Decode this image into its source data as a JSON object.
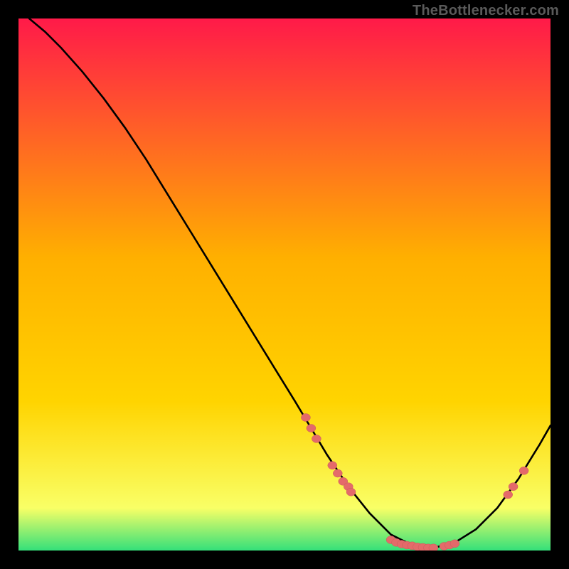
{
  "watermark": "TheBottlenecker.com",
  "colors": {
    "gradient_top": "#ff1a49",
    "gradient_mid": "#ffd400",
    "gradient_low": "#f9ff66",
    "gradient_bottom": "#34e07a",
    "curve": "#000000",
    "marker": "#e46a6a",
    "marker_stroke": "#c95a5a",
    "frame": "#000000"
  },
  "chart_data": {
    "type": "line",
    "title": "",
    "xlabel": "",
    "ylabel": "",
    "xlim": [
      0,
      100
    ],
    "ylim": [
      0,
      100
    ],
    "grid": false,
    "series": [
      {
        "name": "bottleneck-curve",
        "x": [
          2,
          5,
          8,
          12,
          16,
          20,
          24,
          28,
          32,
          36,
          40,
          44,
          48,
          52,
          55,
          58,
          62,
          66,
          70,
          74,
          78,
          82,
          86,
          90,
          94,
          98,
          100
        ],
        "y": [
          100,
          97.5,
          94.5,
          90,
          85,
          79.5,
          73.5,
          67,
          60.5,
          54,
          47.5,
          41,
          34.5,
          28,
          23,
          18,
          12,
          7,
          3,
          1,
          0.5,
          1.5,
          4,
          8,
          13.5,
          20,
          23.5
        ]
      }
    ],
    "markers": [
      {
        "x": 54,
        "y": 25
      },
      {
        "x": 55,
        "y": 23
      },
      {
        "x": 56,
        "y": 21
      },
      {
        "x": 59,
        "y": 16
      },
      {
        "x": 60,
        "y": 14.5
      },
      {
        "x": 61,
        "y": 13
      },
      {
        "x": 62,
        "y": 12
      },
      {
        "x": 62.5,
        "y": 11
      },
      {
        "x": 70,
        "y": 2
      },
      {
        "x": 71,
        "y": 1.5
      },
      {
        "x": 72,
        "y": 1.2
      },
      {
        "x": 73,
        "y": 1
      },
      {
        "x": 74,
        "y": 0.9
      },
      {
        "x": 75,
        "y": 0.7
      },
      {
        "x": 76,
        "y": 0.6
      },
      {
        "x": 77,
        "y": 0.5
      },
      {
        "x": 78,
        "y": 0.5
      },
      {
        "x": 80,
        "y": 0.8
      },
      {
        "x": 81,
        "y": 1.0
      },
      {
        "x": 82,
        "y": 1.3
      },
      {
        "x": 92,
        "y": 10.5
      },
      {
        "x": 93,
        "y": 12
      },
      {
        "x": 95,
        "y": 15
      }
    ]
  }
}
